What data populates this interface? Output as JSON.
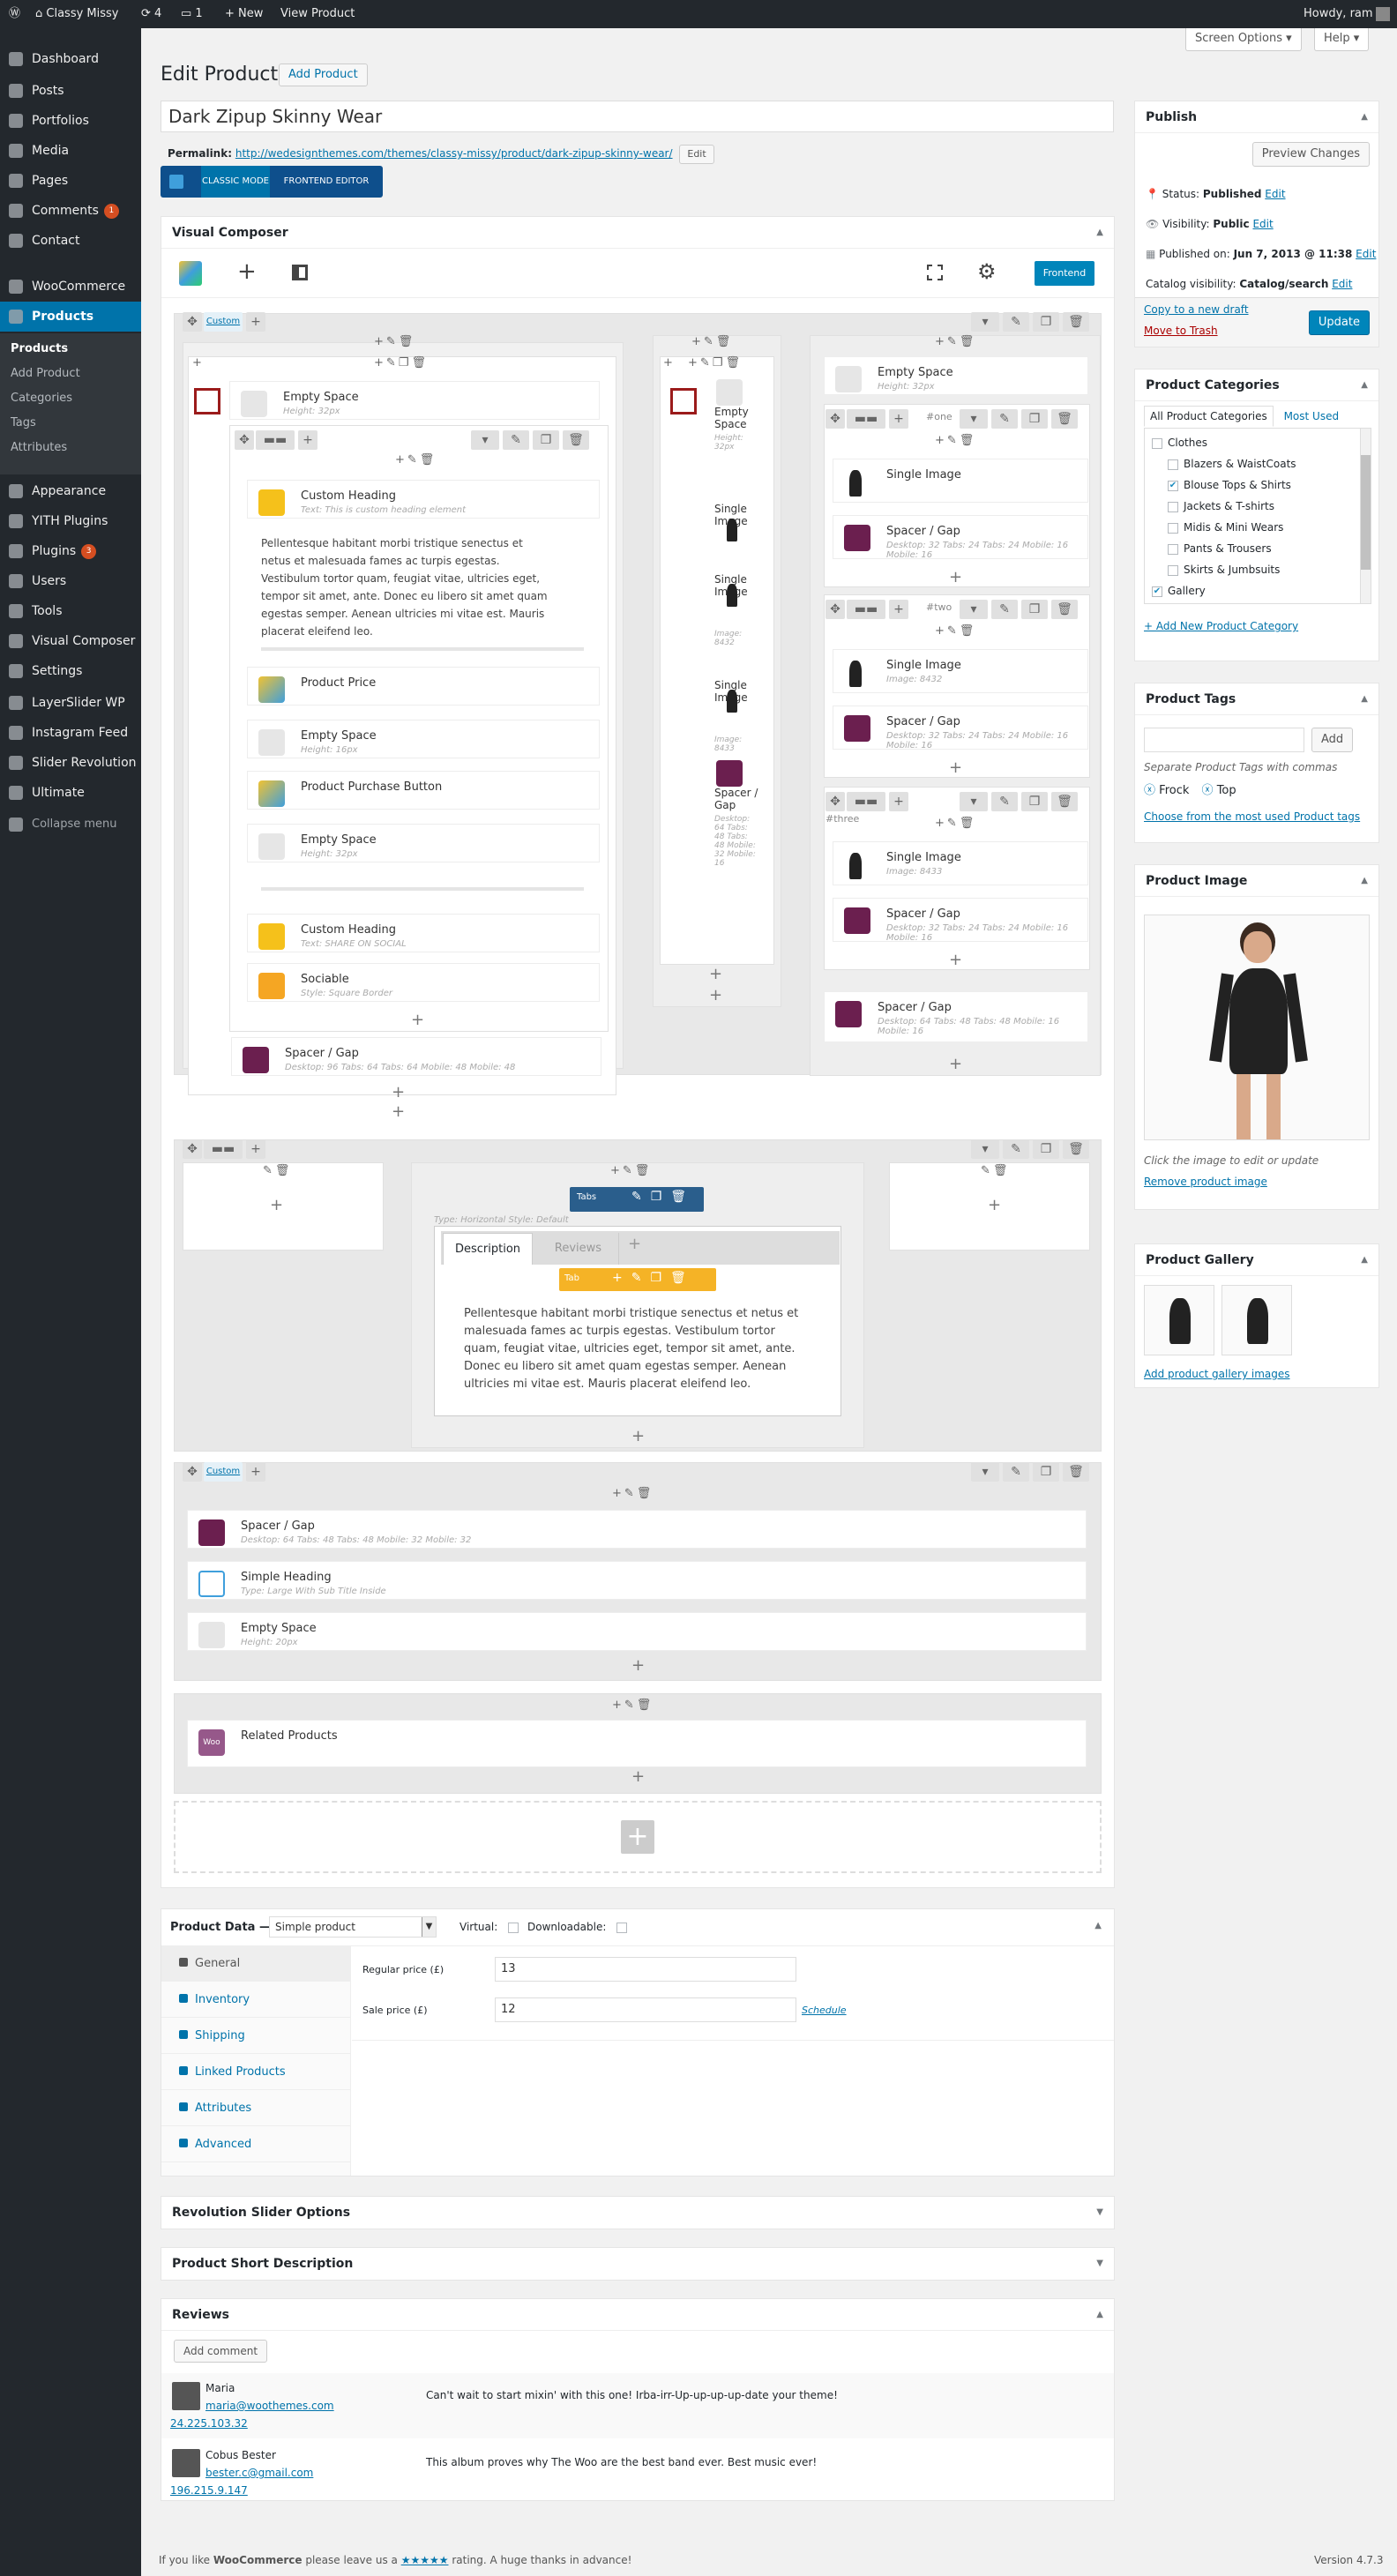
{
  "adminbar": {
    "site": "Classy Missy",
    "updates": "4",
    "comments": "1",
    "new": "New",
    "view": "View Product",
    "howdy": "Howdy, ram"
  },
  "menu": {
    "items": [
      {
        "label": "Dashboard",
        "icon": "dashboard-icon"
      },
      {
        "label": "Posts",
        "icon": "pin-icon"
      },
      {
        "label": "Portfolios",
        "icon": "portfolio-icon"
      },
      {
        "label": "Media",
        "icon": "media-icon"
      },
      {
        "label": "Pages",
        "icon": "page-icon"
      },
      {
        "label": "Comments",
        "icon": "comment-icon",
        "badge": "1"
      },
      {
        "label": "Contact",
        "icon": "mail-icon"
      },
      {
        "label": "WooCommerce",
        "icon": "woo-icon"
      },
      {
        "label": "Products",
        "icon": "products-icon"
      },
      {
        "label": "Appearance",
        "icon": "brush-icon"
      },
      {
        "label": "YITH Plugins",
        "icon": "yith-icon"
      },
      {
        "label": "Plugins",
        "icon": "plugin-icon",
        "badge": "3"
      },
      {
        "label": "Users",
        "icon": "users-icon"
      },
      {
        "label": "Tools",
        "icon": "tools-icon"
      },
      {
        "label": "Visual Composer",
        "icon": "vc-icon"
      },
      {
        "label": "Settings",
        "icon": "settings-icon"
      },
      {
        "label": "LayerSlider WP",
        "icon": "layers-icon"
      },
      {
        "label": "Instagram Feed",
        "icon": "instagram-icon"
      },
      {
        "label": "Slider Revolution",
        "icon": "refresh-icon"
      },
      {
        "label": "Ultimate",
        "icon": "ultimate-icon"
      },
      {
        "label": "Collapse menu",
        "icon": "collapse-icon"
      }
    ],
    "sub": [
      "Products",
      "Add Product",
      "Categories",
      "Tags",
      "Attributes"
    ]
  },
  "screen_options": "Screen Options",
  "help": "Help",
  "page": {
    "title": "Edit Product",
    "add": "Add Product",
    "post_title": "Dark Zipup Skinny Wear",
    "permalink_label": "Permalink:",
    "permalink": "http://wedesignthemes.com/themes/classy-missy/product/dark-zipup-skinny-wear/",
    "edit": "Edit",
    "classic": "CLASSIC MODE",
    "frontend_editor": "FRONTEND EDITOR"
  },
  "vc": {
    "title": "Visual Composer",
    "frontend": "Frontend",
    "custom": "Custom",
    "custom2": "Custom",
    "col1": [
      {
        "t": "Empty Space",
        "s": "Height: 32px"
      },
      {
        "t": "Custom Heading",
        "s": "Text: This is custom heading element"
      },
      {
        "t": "Product Price",
        "s": ""
      },
      {
        "t": "Empty Space",
        "s": "Height: 16px"
      },
      {
        "t": "Product Purchase Button",
        "s": ""
      },
      {
        "t": "Empty Space",
        "s": "Height: 32px"
      },
      {
        "t": "Custom Heading",
        "s": "Text: SHARE ON SOCIAL"
      },
      {
        "t": "Sociable",
        "s": "Style: Square Border"
      },
      {
        "t": "Spacer / Gap",
        "s": "Desktop: 96   Tabs: 64   Tabs: 64   Mobile: 48   Mobile: 48"
      }
    ],
    "lorem": "Pellentesque habitant morbi tristique senectus et netus et malesuada fames ac turpis egestas. Vestibulum tortor quam, feugiat vitae, ultricies eget, tempor sit amet, ante. Donec eu libero sit amet quam egestas semper. Aenean ultricies mi vitae est. Mauris placerat eleifend leo.",
    "col2": [
      {
        "t": "Empty Space",
        "s": "Height: 32px"
      },
      {
        "t": "Single Image",
        "s": ""
      },
      {
        "t": "Single Image",
        "s": "Image: 8432"
      },
      {
        "t": "Single Image",
        "s": "Image: 8433"
      },
      {
        "t": "Spacer / Gap",
        "s": "Desktop: 64 Tabs: 48 Tabs: 48 Mobile: 32 Mobile: 16"
      }
    ],
    "col3": [
      {
        "t": "Empty Space",
        "s": "Height: 32px"
      },
      {
        "t": "Single Image",
        "s": ""
      },
      {
        "t": "Spacer / Gap",
        "s": "Desktop: 32  Tabs: 24  Tabs: 24  Mobile: 16  Mobile: 16"
      },
      {
        "t": "Single Image",
        "s": "Image: 8432"
      },
      {
        "t": "Spacer / Gap",
        "s": "Desktop: 32  Tabs: 24  Tabs: 24  Mobile: 16  Mobile: 16"
      },
      {
        "t": "Single Image",
        "s": "Image: 8433"
      },
      {
        "t": "Spacer / Gap",
        "s": "Desktop: 32  Tabs: 24  Tabs: 24  Mobile: 16  Mobile: 16"
      },
      {
        "t": "Spacer / Gap",
        "s": "Desktop: 64  Tabs: 48  Tabs: 48  Mobile: 16  Mobile: 16"
      }
    ],
    "ids": [
      "#one",
      "#two",
      "#three"
    ],
    "tabs": {
      "label": "Tabs",
      "tab": "Tab",
      "style": "Type: Horizontal  Style: Default",
      "t1": "Description",
      "t2": "Reviews"
    },
    "row3": [
      {
        "t": "Spacer / Gap",
        "s": "Desktop: 64  Tabs: 48  Tabs: 48  Mobile: 32  Mobile: 32"
      },
      {
        "t": "Simple Heading",
        "s": "Type: Large With Sub Title Inside"
      },
      {
        "t": "Empty Space",
        "s": "Height: 20px"
      }
    ],
    "related": "Related Products",
    "woo": "Woo"
  },
  "publish": {
    "title": "Publish",
    "preview": "Preview Changes",
    "status_l": "Status:",
    "status": "Published",
    "visibility_l": "Visibility:",
    "visibility": "Public",
    "published_l": "Published on:",
    "published": "Jun 7, 2013 @ 11:38",
    "catalog_l": "Catalog visibility:",
    "catalog": "Catalog/search",
    "edit": "Edit",
    "copy": "Copy to a new draft",
    "trash": "Move to Trash",
    "update": "Update"
  },
  "cats": {
    "title": "Product Categories",
    "tab_all": "All Product Categories",
    "tab_used": "Most Used",
    "items": [
      {
        "l": "Clothes",
        "c": false
      },
      {
        "l": "Blazers & WaistCoats",
        "c": false
      },
      {
        "l": "Blouse Tops & Shirts",
        "c": true
      },
      {
        "l": "Jackets & T-shirts",
        "c": false
      },
      {
        "l": "Midis & Mini Wears",
        "c": false
      },
      {
        "l": "Pants & Trousers",
        "c": false
      },
      {
        "l": "Skirts & Jumbsuits",
        "c": false
      },
      {
        "l": "Gallery",
        "c": true
      }
    ],
    "add": "+ Add New Product Category"
  },
  "tags": {
    "title": "Product Tags",
    "add": "Add",
    "hint": "Separate Product Tags with commas",
    "t1": "Frock",
    "t2": "Top",
    "choose": "Choose from the most used Product tags"
  },
  "image": {
    "title": "Product Image",
    "hint": "Click the image to edit or update",
    "remove": "Remove product image"
  },
  "gallery": {
    "title": "Product Gallery",
    "add": "Add product gallery images"
  },
  "pdata": {
    "title": "Product Data —",
    "type": "Simple product",
    "virtual": "Virtual:",
    "download": "Downloadable:",
    "tabs": [
      "General",
      "Inventory",
      "Shipping",
      "Linked Products",
      "Attributes",
      "Advanced"
    ],
    "reg_l": "Regular price (£)",
    "reg": "13",
    "sale_l": "Sale price (£)",
    "sale": "12",
    "schedule": "Schedule"
  },
  "rev_slider": "Revolution Slider Options",
  "short_desc": "Product Short Description",
  "reviews": {
    "title": "Reviews",
    "add": "Add comment",
    "items": [
      {
        "name": "Maria",
        "email": "maria@woothemes.com",
        "ip": "24.225.103.32",
        "text": "Can't wait to start mixin' with this one! Irba-irr-Up-up-up-up-date your theme!"
      },
      {
        "name": "Cobus Bester",
        "email": "bester.c@gmail.com",
        "ip": "196.215.9.147",
        "text": "This album proves why The Woo are the best band ever. Best music ever!"
      }
    ]
  },
  "footer": {
    "pre": "If you like",
    "woo": "WooCommerce",
    "mid": "please leave us a",
    "stars": "★★★★★",
    "post": "rating. A huge thanks in advance!",
    "version": "Version 4.7.3"
  }
}
